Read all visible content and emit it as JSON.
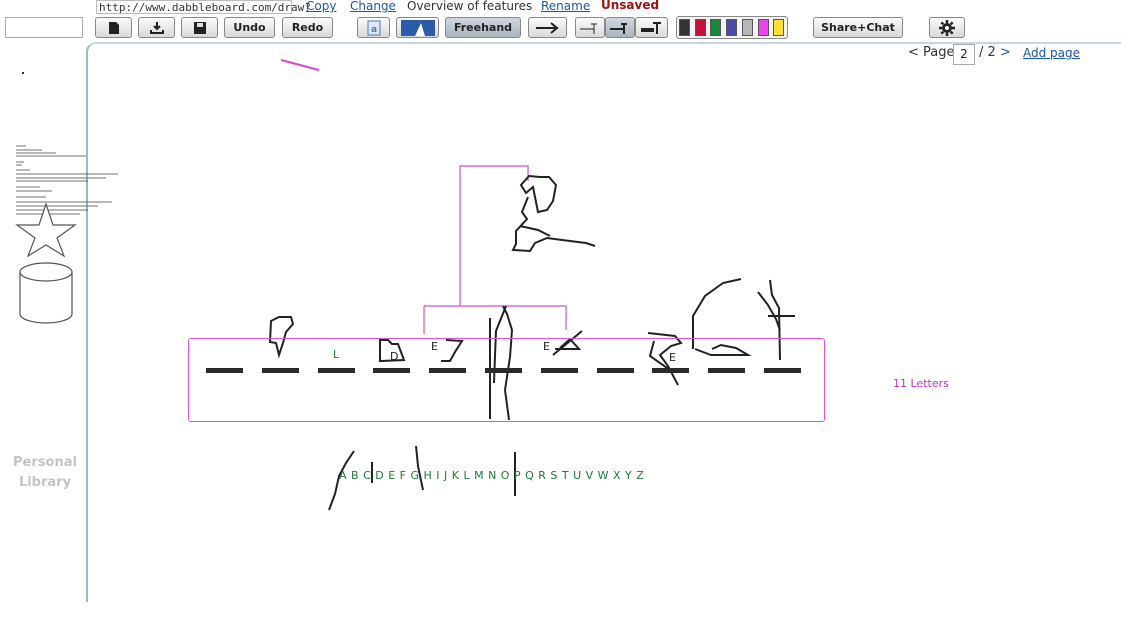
{
  "address": {
    "url": "http://www.dabbleboard.com/draw?"
  },
  "header": {
    "copy_label": "Copy",
    "change_label": "Change",
    "title": "Overview of features",
    "rename_label": "Rename",
    "status": "Unsaved"
  },
  "toolbar": {
    "undo_label": "Undo",
    "redo_label": "Redo",
    "freehand_label": "Freehand",
    "share_label": "Share+Chat",
    "colors": [
      "#333333",
      "#c0143c",
      "#1a8a3a",
      "#4a4aa8",
      "#b8b8b8",
      "#ee44ee",
      "#ffe030"
    ]
  },
  "sidebar": {
    "library_label_line1": "Personal",
    "library_label_line2": "Library"
  },
  "pager": {
    "prefix": "< Page",
    "current": "2",
    "total": "/ 2",
    "next": ">",
    "add_page": "Add page"
  },
  "canvas": {
    "guesses": [
      "L",
      "D",
      "E",
      "E",
      "E"
    ],
    "letter_count": "11 Letters",
    "alphabet": "A B C D E F G H I J K L M N O P Q R S T U V W X Y Z"
  }
}
